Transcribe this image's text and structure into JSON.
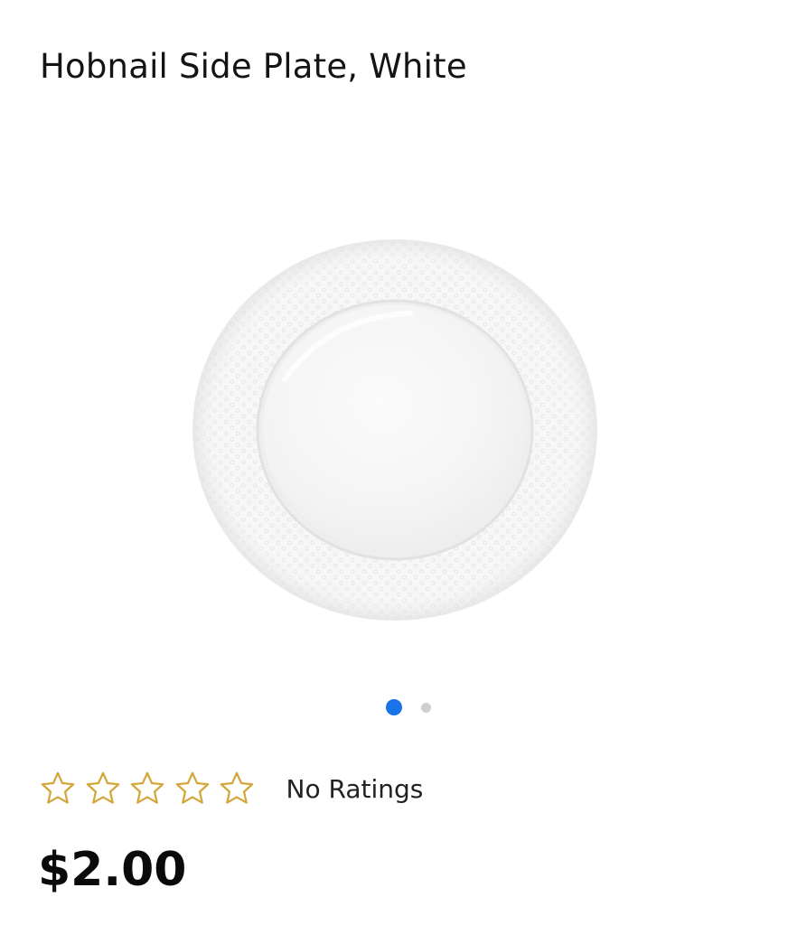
{
  "product": {
    "title": "Hobnail Side Plate, White",
    "price": "$2.00",
    "image_alt": "Hobnail Side Plate, White"
  },
  "gallery": {
    "slide_count": 2,
    "active_slide": 1,
    "active_dot_color": "#1a73e8",
    "inactive_dot_color": "#cfcfcf"
  },
  "rating": {
    "stars_total": 5,
    "stars_filled": 0,
    "star_icon": "star-outline-icon",
    "star_color": "#d4a73b",
    "label": "No Ratings"
  }
}
